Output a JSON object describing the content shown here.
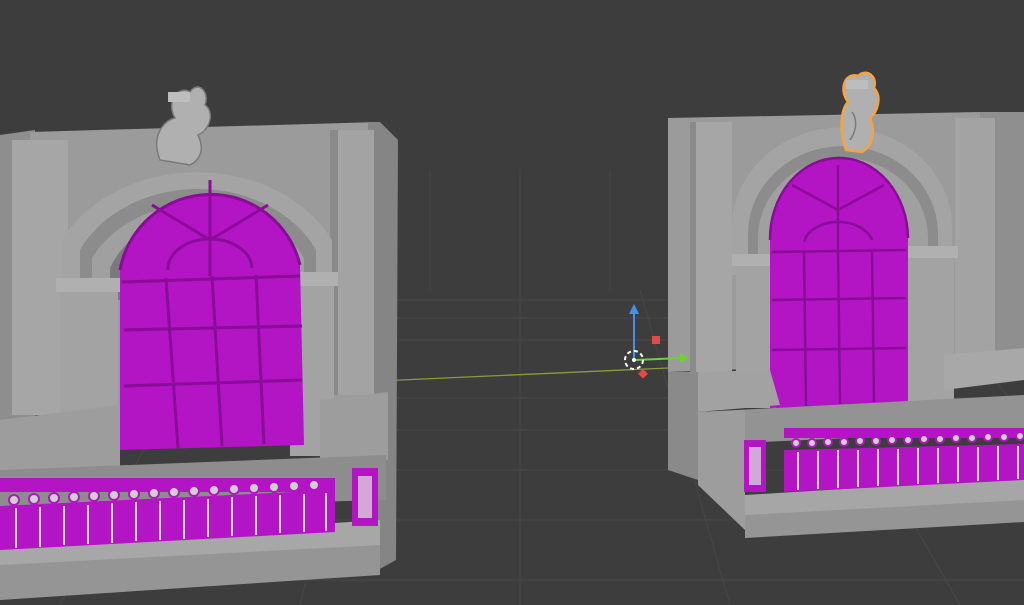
{
  "viewport": {
    "background": "#3d3d3d",
    "grid_color": "#474747",
    "x_axis_color": "#8c9a3c",
    "y_axis_color": "#6a8f3a"
  },
  "materials": {
    "wall": "#9a9a9a",
    "wall_light": "#a9a9a9",
    "wall_dark": "#7e7e7e",
    "wall_shadow": "#6c6c6c",
    "missing_texture": "#b314c4",
    "missing_texture_dark": "#8a0c98",
    "selection_outline": "#f5a442"
  },
  "scene_objects": [
    {
      "id": "window-facade-left",
      "selected": false
    },
    {
      "id": "window-facade-right",
      "selected": false
    },
    {
      "id": "ornament-left",
      "selected": false
    },
    {
      "id": "ornament-right",
      "selected": true
    }
  ],
  "gizmo": {
    "z_color": "#4a90e2",
    "y_color": "#6fcf3a",
    "x_color": "#e24a4a",
    "cursor_ring_color": "#ffffff"
  }
}
